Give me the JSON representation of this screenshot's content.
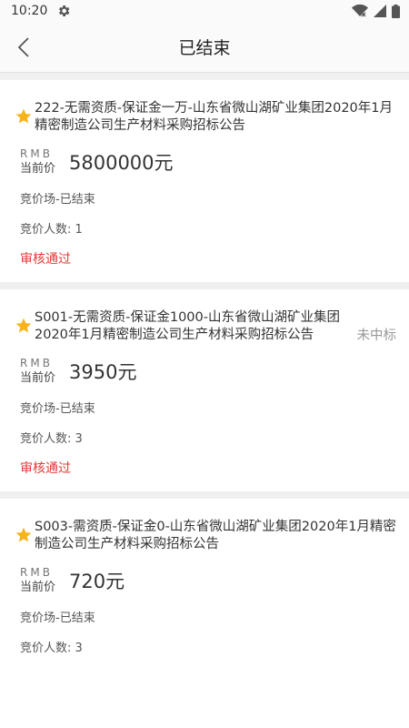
{
  "status_bar": {
    "time": "10:20"
  },
  "header": {
    "title": "已结束"
  },
  "colors": {
    "star": "#f6b31a",
    "approved": "#e53935"
  },
  "cards": [
    {
      "title": "222-无需资质-保证金一万-山东省微山湖矿业集团2020年1月精密制造公司生产材料采购招标公告",
      "badge": "",
      "rmb_label": "RMB",
      "current_label": "当前价",
      "price": "5800000元",
      "venue": "竞价场-已结束",
      "bidders": "竞价人数: 1",
      "status": "审核通过"
    },
    {
      "title": "S001-无需资质-保证金1000-山东省微山湖矿业集团2020年1月精密制造公司生产材料采购招标公告",
      "badge": "未中标",
      "rmb_label": "RMB",
      "current_label": "当前价",
      "price": "3950元",
      "venue": "竞价场-已结束",
      "bidders": "竞价人数: 3",
      "status": "审核通过"
    },
    {
      "title": "S003-需资质-保证金0-山东省微山湖矿业集团2020年1月精密制造公司生产材料采购招标公告",
      "badge": "",
      "rmb_label": "RMB",
      "current_label": "当前价",
      "price": "720元",
      "venue": "竞价场-已结束",
      "bidders": "竞价人数: 3",
      "status": ""
    }
  ]
}
